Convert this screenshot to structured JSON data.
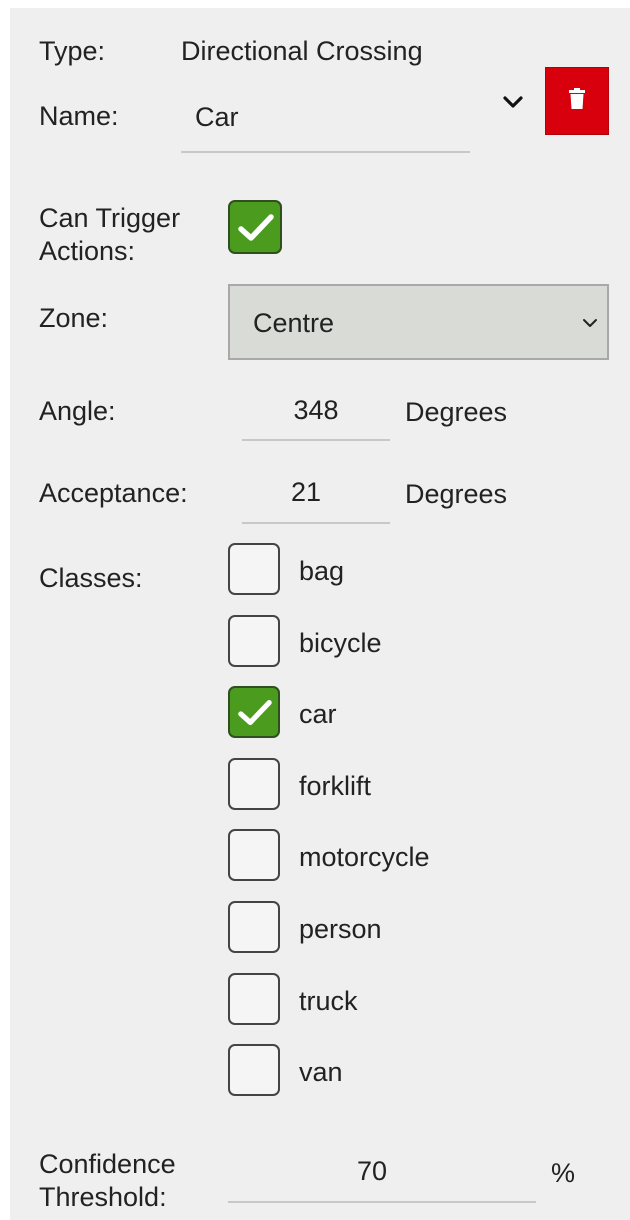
{
  "rule": {
    "type_label": "Type:",
    "type_value": "Directional Crossing",
    "name_label": "Name:",
    "name_value": "Car"
  },
  "trigger": {
    "label_line1": "Can Trigger",
    "label_line2": "Actions:",
    "checked": true
  },
  "zone": {
    "label": "Zone:",
    "selected": "Centre"
  },
  "angle": {
    "label": "Angle:",
    "value": "348",
    "unit": "Degrees"
  },
  "acceptance": {
    "label": "Acceptance:",
    "value": "21",
    "unit": "Degrees"
  },
  "classes": {
    "label": "Classes:",
    "items": [
      {
        "label": "bag",
        "checked": false
      },
      {
        "label": "bicycle",
        "checked": false
      },
      {
        "label": "car",
        "checked": true
      },
      {
        "label": "forklift",
        "checked": false
      },
      {
        "label": "motorcycle",
        "checked": false
      },
      {
        "label": "person",
        "checked": false
      },
      {
        "label": "truck",
        "checked": false
      },
      {
        "label": "van",
        "checked": false
      }
    ]
  },
  "confidence": {
    "label_line1": "Confidence",
    "label_line2": "Threshold:",
    "value": "70",
    "unit": "%"
  },
  "colors": {
    "panel_bg": "#efefef",
    "delete_red": "#d9000d",
    "check_green": "#4a9b1e",
    "select_bg": "#d9dcd6"
  },
  "icons": {
    "delete": "trash-icon",
    "name_dropdown": "chevron-down-icon",
    "zone_dropdown": "chevron-down-icon",
    "check": "checkmark-icon"
  }
}
